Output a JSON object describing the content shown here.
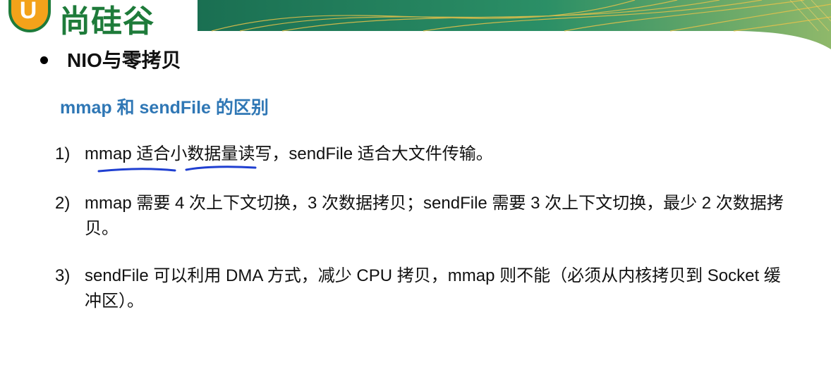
{
  "logo": {
    "u_glyph": "U",
    "text": "尚硅谷"
  },
  "heading": "NIO与零拷贝",
  "subheading": "mmap 和 sendFile 的区别",
  "items": [
    {
      "num": "1)",
      "text": "mmap 适合小数据量读写，sendFile 适合大文件传输。"
    },
    {
      "num": "2)",
      "text": "mmap 需要 4 次上下文切换，3 次数据拷贝；sendFile 需要 3 次上下文切换，最少 2 次数据拷贝。"
    },
    {
      "num": "3)",
      "text": "sendFile 可以利用 DMA 方式，减少 CPU 拷贝，mmap 则不能（必须从内核拷贝到 Socket 缓冲区）。"
    }
  ],
  "colors": {
    "brand_green": "#1e7b3a",
    "brand_orange": "#f3a21a",
    "subheading_blue": "#2f77b5",
    "annotation_blue": "#1f3fd1"
  }
}
